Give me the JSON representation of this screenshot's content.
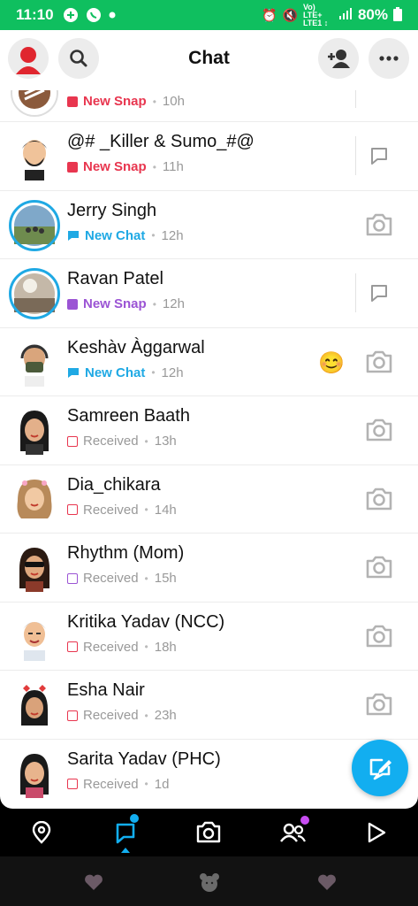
{
  "status_bar": {
    "time": "11:10",
    "battery": "80%",
    "network": "Vo) LTE+ LTE1 ↕"
  },
  "header": {
    "title": "Chat",
    "icons": [
      "profile-avatar",
      "search-icon",
      "add-friend-icon",
      "more-icon"
    ]
  },
  "colors": {
    "snap_red": "#e8364f",
    "chat_blue": "#1fa9e4",
    "snap_purple": "#9b54d4",
    "received_red": "#e8364f",
    "received_purple": "#9b54d4",
    "green_status": "#0fbf5f",
    "fab_blue": "#12aef0"
  },
  "chats": [
    {
      "name": "",
      "status": "New Snap",
      "time": "10h",
      "kind": "snap_red",
      "action": "reply"
    },
    {
      "name": "@# _Killer & Sumo_#@",
      "status": "New Snap",
      "time": "11h",
      "kind": "snap_red",
      "action": "reply"
    },
    {
      "name": "Jerry Singh",
      "status": "New Chat",
      "time": "12h",
      "kind": "chat_blue",
      "action": "camera"
    },
    {
      "name": "Ravan Patel",
      "status": "New Snap",
      "time": "12h",
      "kind": "snap_purple",
      "action": "reply"
    },
    {
      "name": "Keshàv Àggarwal",
      "status": "New Chat",
      "time": "12h",
      "kind": "chat_blue",
      "action": "camera",
      "emoji": "😊"
    },
    {
      "name": "Samreen Baath",
      "status": "Received",
      "time": "13h",
      "kind": "received_red",
      "action": "camera"
    },
    {
      "name": "Dia_chikara",
      "status": "Received",
      "time": "14h",
      "kind": "received_red",
      "action": "camera"
    },
    {
      "name": "Rhythm (Mom)",
      "status": "Received",
      "time": "15h",
      "kind": "received_purple",
      "action": "camera"
    },
    {
      "name": "Kritika Yadav (NCC)",
      "status": "Received",
      "time": "18h",
      "kind": "received_red",
      "action": "camera"
    },
    {
      "name": "Esha Nair",
      "status": "Received",
      "time": "23h",
      "kind": "received_red",
      "action": "camera"
    },
    {
      "name": "Sarita Yadav (PHC)",
      "status": "Received",
      "time": "1d",
      "kind": "received_red",
      "action": "none"
    }
  ],
  "bottom_nav": [
    "map-icon",
    "chat-icon",
    "camera-icon",
    "stories-icon",
    "spotlight-icon"
  ]
}
